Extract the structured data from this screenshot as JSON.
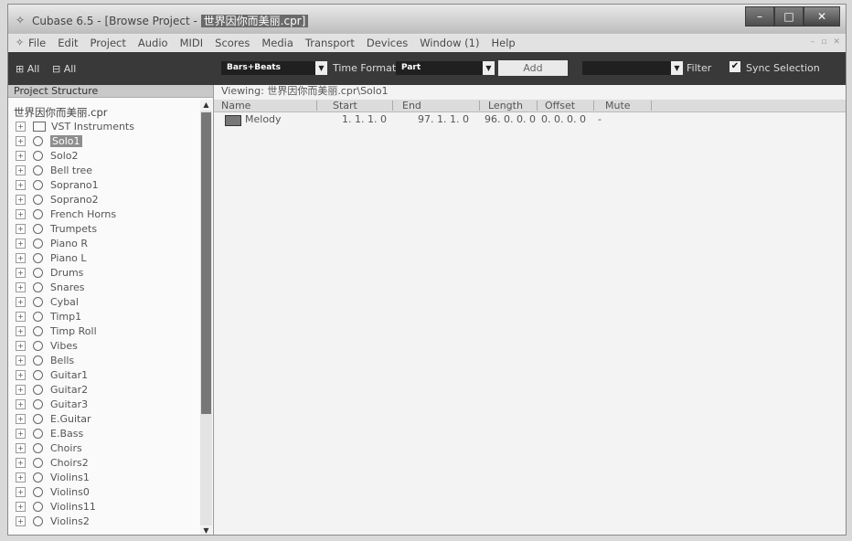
{
  "window": {
    "title_prefix": "Cubase 6.5 - [Browse Project - ",
    "title_highlight": "世界因你而美丽.cpr]",
    "minimize": "–",
    "maximize": "□",
    "close": "✕"
  },
  "menu": {
    "items": [
      "File",
      "Edit",
      "Project",
      "Audio",
      "MIDI",
      "Scores",
      "Media",
      "Transport",
      "Devices",
      "Window (1)",
      "Help"
    ],
    "doc_controls": [
      "–",
      "▫",
      "✕"
    ]
  },
  "toolbar": {
    "expand_all": "⊞ All",
    "collapse_all": "⊟ All",
    "time_format_value": "Bars+Beats",
    "time_format_label": "Time Format",
    "type_value": "Part",
    "add_label": "Add",
    "filter_value": "",
    "filter_label": "Filter",
    "sync_label": "Sync Selection",
    "sync_checked": true
  },
  "project_structure": {
    "header": "Project Structure",
    "root": "世界因你而美丽.cpr",
    "items": [
      {
        "label": "VST Instruments",
        "type": "folder"
      },
      {
        "label": "Solo1",
        "type": "track",
        "selected": true
      },
      {
        "label": "Solo2",
        "type": "track"
      },
      {
        "label": "Bell tree",
        "type": "track"
      },
      {
        "label": "Soprano1",
        "type": "track"
      },
      {
        "label": "Soprano2",
        "type": "track"
      },
      {
        "label": "French Horns",
        "type": "track"
      },
      {
        "label": "Trumpets",
        "type": "track"
      },
      {
        "label": "Piano R",
        "type": "track"
      },
      {
        "label": "Piano L",
        "type": "track"
      },
      {
        "label": "Drums",
        "type": "track"
      },
      {
        "label": "Snares",
        "type": "track"
      },
      {
        "label": "Cybal",
        "type": "track"
      },
      {
        "label": "Timp1",
        "type": "track"
      },
      {
        "label": "Timp Roll",
        "type": "track"
      },
      {
        "label": "Vibes",
        "type": "track"
      },
      {
        "label": "Bells",
        "type": "track"
      },
      {
        "label": "Guitar1",
        "type": "track"
      },
      {
        "label": "Guitar2",
        "type": "track"
      },
      {
        "label": "Guitar3",
        "type": "track"
      },
      {
        "label": "E.Guitar",
        "type": "track"
      },
      {
        "label": "E.Bass",
        "type": "track"
      },
      {
        "label": "Choirs",
        "type": "track"
      },
      {
        "label": "Choirs2",
        "type": "track"
      },
      {
        "label": "Violins1",
        "type": "track"
      },
      {
        "label": "Violins0",
        "type": "track"
      },
      {
        "label": "Violins11",
        "type": "track"
      },
      {
        "label": "Violins2",
        "type": "track"
      }
    ]
  },
  "event_list": {
    "viewing": "Viewing: 世界因你而美丽.cpr\\Solo1",
    "columns": [
      "Name",
      "Start",
      "End",
      "Length",
      "Offset",
      "Mute"
    ],
    "rows": [
      {
        "name": "Melody",
        "start": "1. 1. 1.   0",
        "end": "97. 1. 1.   0",
        "length": "96. 0. 0.   0",
        "offset": "0. 0. 0.   0",
        "mute": "-"
      }
    ]
  }
}
